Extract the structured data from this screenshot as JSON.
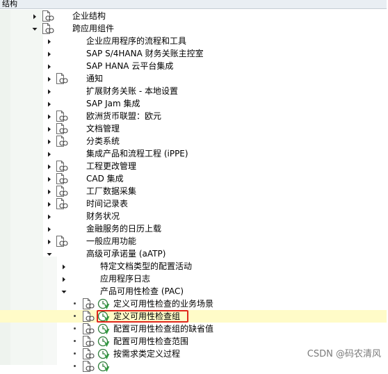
{
  "header": {
    "title": "结构"
  },
  "tree": {
    "rows": [
      {
        "label": "企业结构",
        "level": 1,
        "expander": "collapsed",
        "doc_icon": true,
        "clock_icon": false
      },
      {
        "label": "跨应用组件",
        "level": 1,
        "expander": "expanded",
        "doc_icon": true,
        "clock_icon": false
      },
      {
        "label": "企业应用程序的流程和工具",
        "level": 2,
        "expander": "collapsed",
        "doc_icon": false,
        "clock_icon": false
      },
      {
        "label": "SAP S/4HANA 财务关账主控室",
        "level": 2,
        "expander": "collapsed",
        "doc_icon": false,
        "clock_icon": false
      },
      {
        "label": "SAP HANA 云平台集成",
        "level": 2,
        "expander": "collapsed",
        "doc_icon": false,
        "clock_icon": false
      },
      {
        "label": "通知",
        "level": 2,
        "expander": "collapsed",
        "doc_icon": true,
        "clock_icon": false
      },
      {
        "label": "扩展财务关账 - 本地设置",
        "level": 2,
        "expander": "collapsed",
        "doc_icon": false,
        "clock_icon": false
      },
      {
        "label": "SAP Jam 集成",
        "level": 2,
        "expander": "collapsed",
        "doc_icon": false,
        "clock_icon": false
      },
      {
        "label": "欧洲货币联盟：欧元",
        "level": 2,
        "expander": "collapsed",
        "doc_icon": true,
        "clock_icon": false
      },
      {
        "label": "文档管理",
        "level": 2,
        "expander": "collapsed",
        "doc_icon": true,
        "clock_icon": false
      },
      {
        "label": "分类系统",
        "level": 2,
        "expander": "collapsed",
        "doc_icon": true,
        "clock_icon": false
      },
      {
        "label": "集成产品和流程工程 (iPPE)",
        "level": 2,
        "expander": "collapsed",
        "doc_icon": false,
        "clock_icon": false
      },
      {
        "label": "工程更改管理",
        "level": 2,
        "expander": "collapsed",
        "doc_icon": true,
        "clock_icon": false
      },
      {
        "label": "CAD 集成",
        "level": 2,
        "expander": "collapsed",
        "doc_icon": true,
        "clock_icon": false
      },
      {
        "label": "工厂数据采集",
        "level": 2,
        "expander": "collapsed",
        "doc_icon": true,
        "clock_icon": false
      },
      {
        "label": "时间记录表",
        "level": 2,
        "expander": "collapsed",
        "doc_icon": true,
        "clock_icon": false
      },
      {
        "label": "财务状况",
        "level": 2,
        "expander": "collapsed",
        "doc_icon": false,
        "clock_icon": false
      },
      {
        "label": "金融服务的日历上载",
        "level": 2,
        "expander": "collapsed",
        "doc_icon": false,
        "clock_icon": false
      },
      {
        "label": "一般应用功能",
        "level": 2,
        "expander": "collapsed",
        "doc_icon": true,
        "clock_icon": false
      },
      {
        "label": "高级可承诺量 (aATP)",
        "level": 2,
        "expander": "expanded",
        "doc_icon": false,
        "clock_icon": false
      },
      {
        "label": "特定文档类型的配置活动",
        "level": 3,
        "expander": "collapsed",
        "doc_icon": false,
        "clock_icon": false
      },
      {
        "label": "应用程序日志",
        "level": 3,
        "expander": "collapsed",
        "doc_icon": false,
        "clock_icon": false
      },
      {
        "label": "产品可用性检查 (PAC)",
        "level": 3,
        "expander": "expanded",
        "doc_icon": false,
        "clock_icon": false
      },
      {
        "label": "定义可用性检查的业务场景",
        "level": 4,
        "expander": "leaf",
        "doc_icon": true,
        "clock_icon": true
      },
      {
        "label": "定义可用性检查组",
        "level": 4,
        "expander": "leaf",
        "doc_icon": true,
        "clock_icon": true,
        "highlighted": true
      },
      {
        "label": "配置可用性检查组的缺省值",
        "level": 4,
        "expander": "leaf",
        "doc_icon": true,
        "clock_icon": true
      },
      {
        "label": "配置可用性检查范围",
        "level": 4,
        "expander": "leaf",
        "doc_icon": true,
        "clock_icon": true
      },
      {
        "label": "按需求类定义过程",
        "level": 4,
        "expander": "leaf",
        "doc_icon": true,
        "clock_icon": true
      },
      {
        "label": "",
        "level": 4,
        "expander": "leaf",
        "doc_icon": true,
        "clock_icon": true
      }
    ]
  },
  "watermark": "CSDN @码农清风",
  "colors": {
    "highlight": "#fffbc8",
    "selection_border": "#e0271b",
    "clock_green": "#2e9a3e"
  }
}
